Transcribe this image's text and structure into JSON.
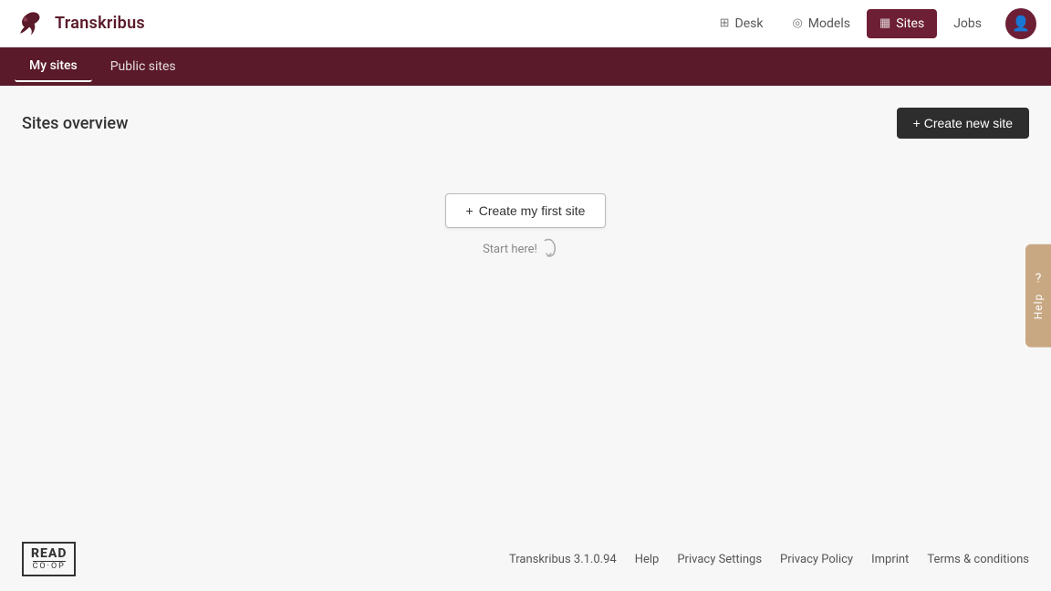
{
  "app": {
    "logo_text": "Transkribus",
    "logo_alt": "Transkribus bird logo"
  },
  "top_nav": {
    "items": [
      {
        "id": "desk",
        "label": "Desk",
        "icon": "⊞",
        "active": false
      },
      {
        "id": "models",
        "label": "Models",
        "icon": "◎",
        "active": false
      },
      {
        "id": "sites",
        "label": "Sites",
        "icon": "⊟",
        "active": true
      },
      {
        "id": "jobs",
        "label": "Jobs",
        "active": false
      }
    ],
    "avatar_icon": "👤"
  },
  "sub_nav": {
    "items": [
      {
        "id": "my-sites",
        "label": "My sites",
        "active": true
      },
      {
        "id": "public-sites",
        "label": "Public sites",
        "active": false
      }
    ]
  },
  "page": {
    "title": "Sites overview",
    "create_new_label": "+ Create new site",
    "create_first_label": "+ Create my first site",
    "start_here_label": "Start here!"
  },
  "footer": {
    "version": "Transkribus 3.1.0.94",
    "links": [
      {
        "id": "help",
        "label": "Help"
      },
      {
        "id": "privacy-settings",
        "label": "Privacy Settings"
      },
      {
        "id": "privacy-policy",
        "label": "Privacy Policy"
      },
      {
        "id": "imprint",
        "label": "Imprint"
      },
      {
        "id": "terms",
        "label": "Terms & conditions"
      }
    ],
    "read_coop": {
      "read": "READ",
      "coop": "CO·OP"
    }
  },
  "help_sidebar": {
    "icon": "?",
    "label": "Help"
  }
}
